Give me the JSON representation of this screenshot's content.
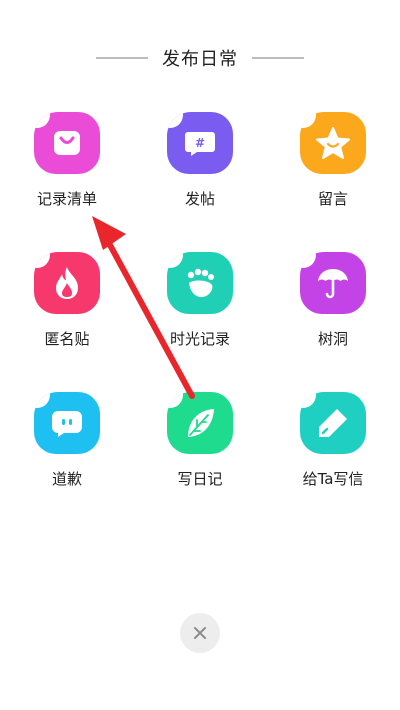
{
  "header": {
    "title": "发布日常"
  },
  "items": [
    {
      "label": "记录清单",
      "icon": "shopping-bag-icon",
      "color": "#ea4cd8"
    },
    {
      "label": "发帖",
      "icon": "hashtag-chat-icon",
      "color": "#7b5cf0"
    },
    {
      "label": "留言",
      "icon": "star-smile-icon",
      "color": "#fba81c"
    },
    {
      "label": "匿名贴",
      "icon": "flame-icon",
      "color": "#f7386d"
    },
    {
      "label": "时光记录",
      "icon": "footprint-icon",
      "color": "#1fd0b4"
    },
    {
      "label": "树洞",
      "icon": "umbrella-icon",
      "color": "#c443e6"
    },
    {
      "label": "道歉",
      "icon": "chat-bubble-icon",
      "color": "#1ec0f2"
    },
    {
      "label": "写日记",
      "icon": "leaf-icon",
      "color": "#1edb8e"
    },
    {
      "label": "给Ta写信",
      "icon": "pen-icon",
      "color": "#1fd0c2"
    }
  ],
  "close": {
    "icon": "close-icon"
  },
  "annotation": {
    "icon": "red-arrow",
    "color": "#e8262b"
  }
}
